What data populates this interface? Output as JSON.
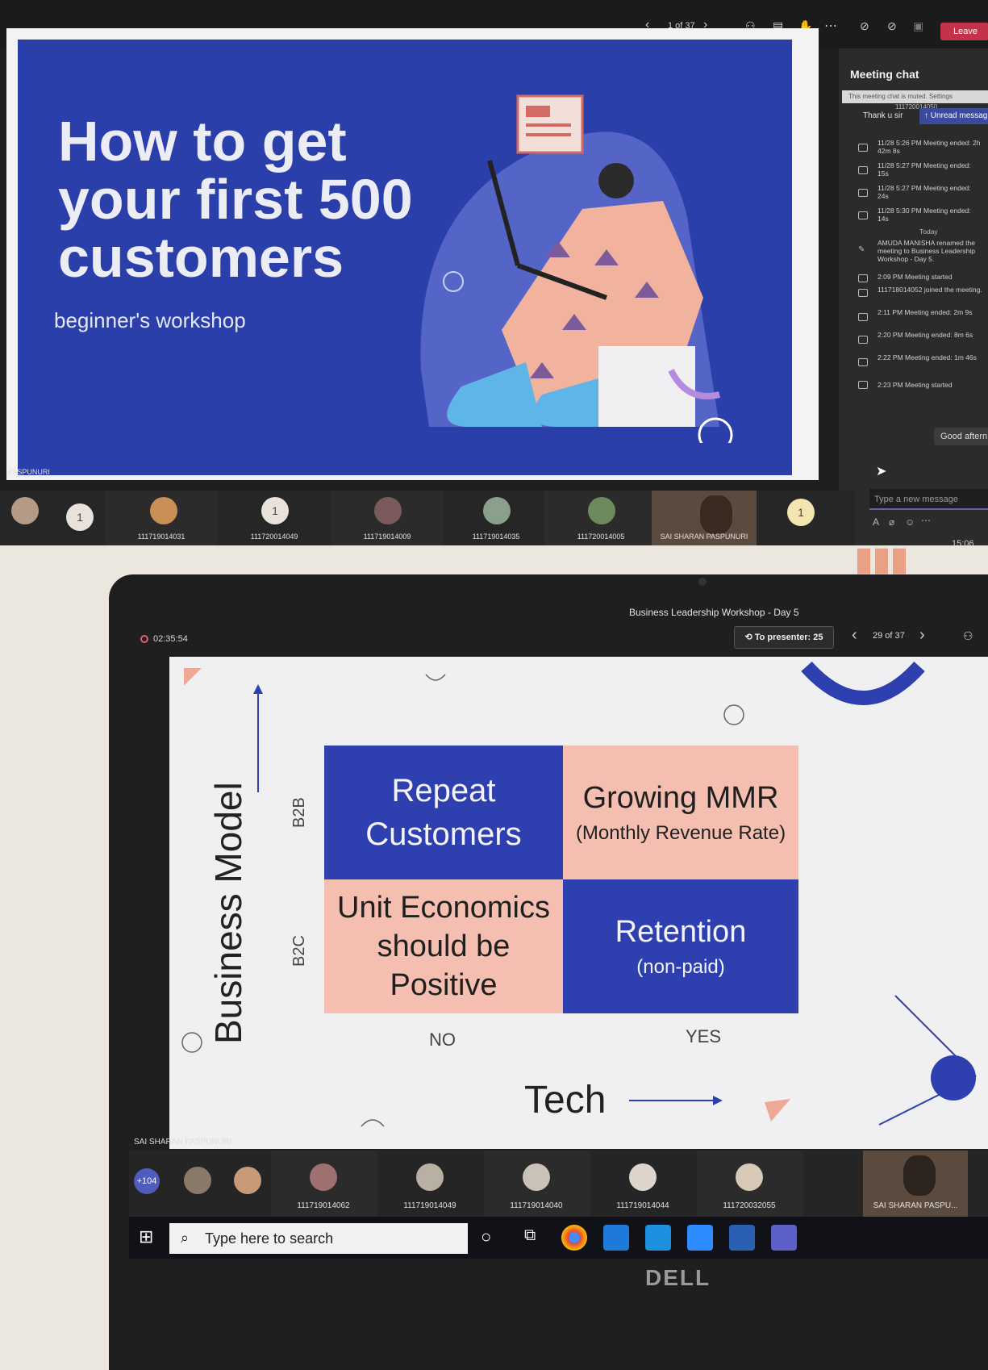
{
  "top": {
    "toolbar": {
      "page": "1 of 37",
      "leave": "Leave"
    },
    "slide": {
      "title_line1": "How to get",
      "title_line2": "your first 500",
      "title_line3": "customers",
      "subtitle": "beginner's workshop"
    },
    "presenter_name": "PASPUNURI",
    "chat": {
      "header": "Meeting chat",
      "muted_notice": "This meeting chat is muted. Settings",
      "unread": "Unread messag",
      "top_id": "111720014050",
      "thanku": "Thank u sir",
      "events": [
        {
          "time": "11/28 5:26 PM",
          "text": "Meeting ended: 2h 42m 8s"
        },
        {
          "time": "11/28 5:27 PM",
          "text": "Meeting ended: 15s"
        },
        {
          "time": "11/28 5:27 PM",
          "text": "Meeting ended: 24s"
        },
        {
          "time": "11/28 5:30 PM",
          "text": "Meeting ended: 14s"
        }
      ],
      "today": "Today",
      "renamed": "AMUDA MANISHA renamed the meeting to Business Leadership Workshop - Day 5.",
      "events_today": [
        {
          "time": "2:09 PM",
          "text": "Meeting started"
        },
        {
          "time": "",
          "text": "111718014052 joined the meeting."
        },
        {
          "time": "2:11 PM",
          "text": "Meeting ended: 2m 9s"
        },
        {
          "time": "2:20 PM",
          "text": "Meeting ended: 8m 6s"
        },
        {
          "time": "2:22 PM",
          "text": "Meeting ended: 1m 46s"
        },
        {
          "time": "2:23 PM",
          "text": "Meeting started"
        }
      ],
      "good_afternoon": "Good aftern",
      "input_placeholder": "Type a new message",
      "clock": "15:06"
    },
    "participants": [
      {
        "name": "",
        "badge": "1"
      },
      {
        "name": "111719014031",
        "badge": ""
      },
      {
        "name": "111720014049",
        "badge": "1"
      },
      {
        "name": "111719014009",
        "badge": ""
      },
      {
        "name": "111719014035",
        "badge": ""
      },
      {
        "name": "111720014005",
        "badge": ""
      },
      {
        "name": "SAI SHARAN PASPUNURI",
        "badge": ""
      },
      {
        "name": "",
        "badge": "1"
      }
    ]
  },
  "bottom": {
    "meeting_title": "Business Leadership Workshop - Day 5",
    "timer": "02:35:54",
    "to_presenter": "To presenter: 25",
    "page": "29 of 37",
    "slide": {
      "y_axis": "Business Model",
      "b2b": "B2B",
      "b2c": "B2C",
      "q1_line1": "Repeat",
      "q1_line2": "Customers",
      "q2_title": "Growing MMR",
      "q2_sub": "(Monthly Revenue Rate)",
      "q3_line1": "Unit Economics",
      "q3_line2": "should be",
      "q3_line3": "Positive",
      "q4_title": "Retention",
      "q4_sub": "(non-paid)",
      "no": "NO",
      "yes": "YES",
      "x_axis": "Tech"
    },
    "presenter_label": "SAI SHARAN PASPUNURI",
    "more_count": "+104",
    "participants": [
      "111719014062",
      "111719014049",
      "111719014040",
      "111719014044",
      "111720032055",
      "SAI SHARAN PASPU..."
    ],
    "search_placeholder": "Type here to search",
    "brand": "DELL"
  }
}
